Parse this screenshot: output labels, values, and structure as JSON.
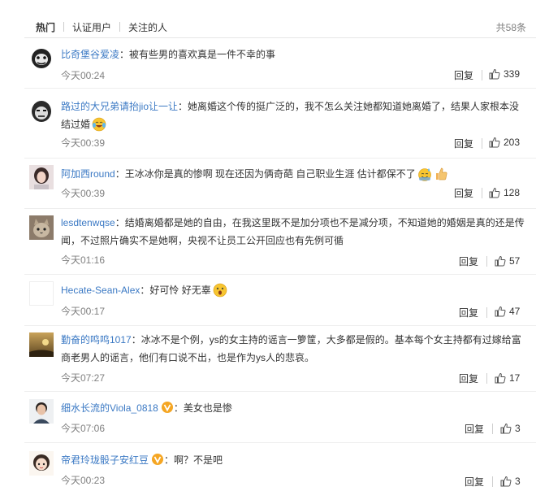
{
  "tabs": [
    {
      "label": "热门",
      "active": true
    },
    {
      "label": "认证用户",
      "active": false
    },
    {
      "label": "关注的人",
      "active": false
    }
  ],
  "total_count": "共58条",
  "reply_label": "回复",
  "colors": {
    "username": "#3b79c4",
    "meta": "#808080",
    "badge": "#f5a623"
  },
  "comments": [
    {
      "user": "比奇堡谷爱凌",
      "colon": "：",
      "text": "被有些男的喜欢真是一件不幸的事",
      "time": "今天00:24",
      "likes": "339",
      "avatar": "meme-face"
    },
    {
      "user": "路过的大兄弟请抬jio让一让",
      "colon": "：",
      "text": "她离婚这个传的挺广泛的，我不怎么关注她都知道她离婚了，结果人家根本没结过婚",
      "emoji": "laughing-tears",
      "time": "今天00:39",
      "likes": "203",
      "avatar": "meme-face"
    },
    {
      "user": "阿加西round",
      "colon": "：",
      "text": "王冰冰你是真的惨啊 现在还因为俩奇葩 自己职业生涯 估计都保不了",
      "emoji": "sweat-smile thumbs-up",
      "time": "今天00:39",
      "likes": "128",
      "avatar": "woman-photo"
    },
    {
      "user": "lesdtenwqse",
      "colon": "：",
      "text": "结婚离婚都是她的自由，在我这里既不是加分项也不是减分项，不知道她的婚姻是真的还是传闻，不过照片确实不是她啊，央视不让员工公开回应也有先例可循",
      "time": "今天01:16",
      "likes": "57",
      "avatar": "cat-photo"
    },
    {
      "user": "Hecate-Sean-Alex",
      "colon": "：",
      "text": "好可怜 好无辜",
      "emoji": "shocked-face",
      "time": "今天00:17",
      "likes": "47",
      "avatar": "blank"
    },
    {
      "user": "勤奋的鸣鸣1017",
      "colon": "：",
      "text": "冰冰不是个例，ys的女主持的谣言一箩筐，大多都是假的。基本每个女主持都有过嫁给富商老男人的谣言，他们有口说不出，也是作为ys人的悲哀。",
      "time": "今天07:27",
      "likes": "17",
      "avatar": "sunset-photo"
    },
    {
      "user": "细水长流的Viola_0818",
      "verified": true,
      "colon": "：",
      "text": "美女也是惨",
      "time": "今天07:06",
      "likes": "3",
      "avatar": "man-photo"
    },
    {
      "user": "帝君玲珑骰子安红豆",
      "verified": true,
      "colon": "：",
      "text": "啊？不是吧",
      "time": "今天00:23",
      "likes": "3",
      "avatar": "cartoon-girl"
    }
  ]
}
